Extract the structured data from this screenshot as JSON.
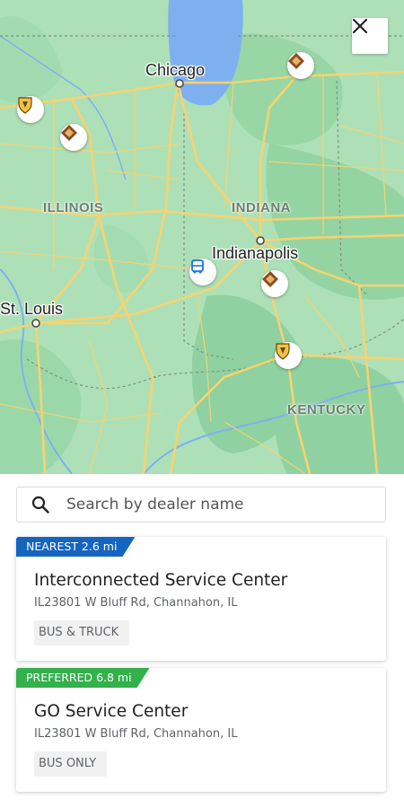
{
  "map": {
    "cities": {
      "chicago": "Chicago",
      "indianapolis": "Indianapolis",
      "st_louis": "St. Louis"
    },
    "states": {
      "illinois": "ILLINOIS",
      "indiana": "INDIANA",
      "kentucky": "KENTUCKY"
    },
    "colors": {
      "land": "#aee0b8",
      "forest": "#8fd1a0",
      "water": "#7eb0f0",
      "highway": "#f7d36f"
    },
    "markers": [
      {
        "name": "dealer-marker-shield-icon"
      },
      {
        "name": "dealer-marker-diamond-icon"
      },
      {
        "name": "dealer-marker-diamond-icon"
      },
      {
        "name": "dealer-marker-diamond-icon"
      },
      {
        "name": "dealer-marker-shield-icon"
      },
      {
        "name": "bus-marker-icon"
      }
    ]
  },
  "close_button": {
    "icon": "close-icon"
  },
  "search": {
    "placeholder": "Search by dealer name",
    "icon": "search-icon"
  },
  "dealers": [
    {
      "tag": "NEAREST 2.6 mi",
      "tag_color": "#1565c0",
      "name": "Interconnected Service Center",
      "address": "IL23801 W Bluff Rd, Channahon, IL",
      "service": "BUS & TRUCK"
    },
    {
      "tag": "PREFERRED 6.8 mi",
      "tag_color": "#33b14b",
      "name": "GO Service Center",
      "address": "IL23801 W Bluff Rd, Channahon, IL",
      "service": "BUS ONLY"
    }
  ]
}
